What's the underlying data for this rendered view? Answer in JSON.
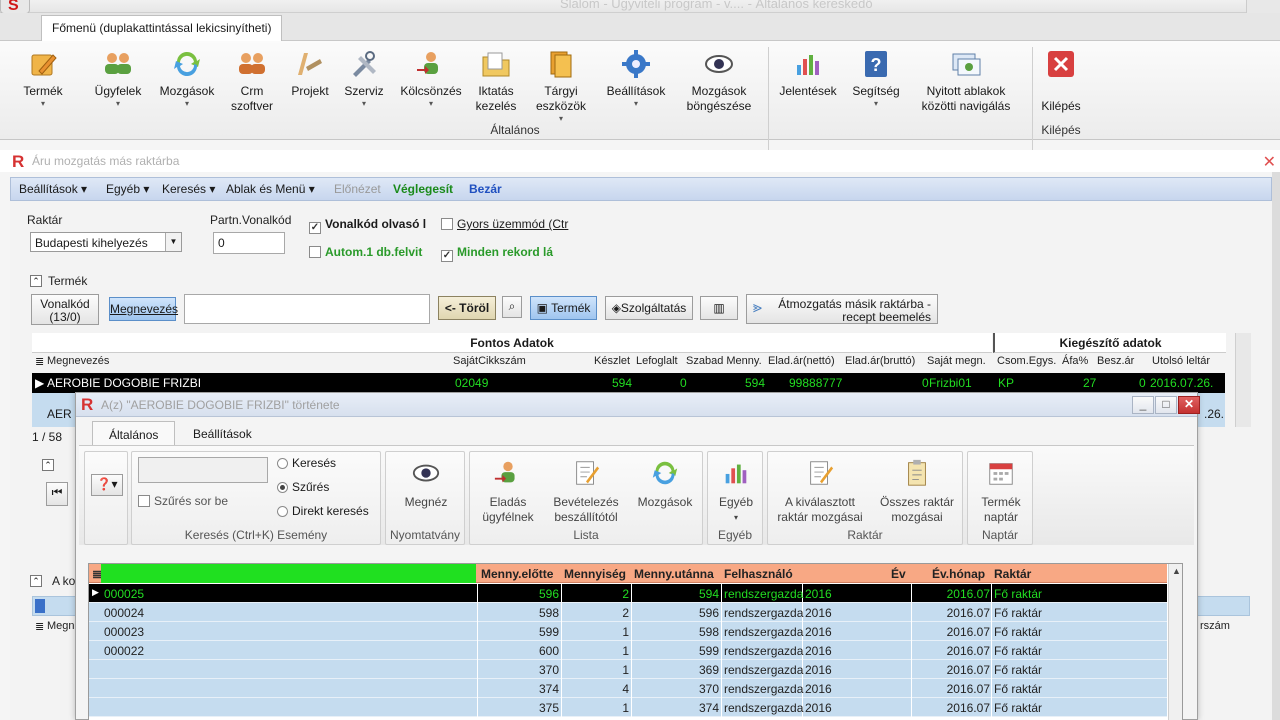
{
  "app": {
    "logo_letter": "S",
    "title": "Slalom - Ügyviteli program - v.... - Általános kereskedő",
    "main_tab": "Főmenü (duplakattintással lekicsinyítheti)"
  },
  "ribbon": {
    "buttons": [
      {
        "label": "Termék",
        "icon": "product-icon"
      },
      {
        "label": "Ügyfelek",
        "icon": "customers-icon"
      },
      {
        "label": "Mozgások",
        "icon": "movements-icon"
      },
      {
        "label": "Crm szoftver",
        "icon": "crm-icon"
      },
      {
        "label": "Projekt",
        "icon": "project-icon"
      },
      {
        "label": "Szerviz",
        "icon": "service-icon"
      },
      {
        "label": "Kölcsönzés",
        "icon": "rental-icon"
      },
      {
        "label": "Iktatás kezelés",
        "icon": "filing-icon"
      },
      {
        "label": "Tárgyi eszközök",
        "icon": "assets-icon"
      },
      {
        "label": "Beállítások",
        "icon": "settings-gear-icon"
      },
      {
        "label": "Mozgások böngészése",
        "icon": "browse-eye-icon"
      },
      {
        "label": "Jelentések",
        "icon": "reports-chart-icon"
      },
      {
        "label": "Segítség",
        "icon": "help-icon"
      },
      {
        "label": "Nyitott ablakok közötti navigálás",
        "icon": "windows-nav-icon"
      },
      {
        "label": "Kilépés",
        "icon": "exit-icon"
      }
    ],
    "group_general": "Általános",
    "group_exit": "Kilépés"
  },
  "form": {
    "title": "Áru mozgatás más raktárba",
    "menu": {
      "settings": "Beállítások",
      "other": "Egyéb",
      "search": "Keresés",
      "window_menu": "Ablak és Menü",
      "preview": "Előnézet",
      "finalize": "Véglegesít",
      "close": "Bezár"
    },
    "warehouse_label": "Raktár",
    "warehouse_value": "Budapesti kihelyezés",
    "partner_barcode_label": "Partn.Vonalkód",
    "partner_barcode_value": "0",
    "chk_barcode_reader": "Vonalkód olvasó l",
    "chk_fast_mode": "Gyors üzemmód (Ctr",
    "chk_auto_one": "Autom.1 db.felvit",
    "chk_all_records": "Minden rekord lá",
    "product_section": "Termék",
    "btn_barcode": "Vonalkód\n(13/0)",
    "btn_name": "Megnevezés",
    "search_value": "",
    "btn_delete": "<- Töröl",
    "btn_product": "Termék",
    "btn_service": "Szolgáltatás",
    "btn_move": "Átmozgatás másik raktárba - recept beemelés",
    "band_important": "Fontos Adatok",
    "band_extra": "Kiegészítő adatok",
    "columns": [
      "Megnevezés",
      "SajátCikkszám",
      "Készlet",
      "Lefoglalt",
      "Szabad Menny.",
      "Elad.ár(nettó)",
      "Elad.ár(bruttó)",
      "Saját megn.",
      "Csom.Egys.",
      "Áfa%",
      "Besz.ár",
      "Utolsó leltár"
    ],
    "row1": {
      "name": "AEROBIE DOGOBIE FRIZBI",
      "code": "02049",
      "stock": "594",
      "reserved": "0",
      "free": "594",
      "net": "99888777",
      "gross": "0",
      "own": "Frizbi01",
      "pack": "KP",
      "vat": "27",
      "buy": "0",
      "inventory": "2016.07.26."
    },
    "row2_partial": "AER",
    "row2_date": ".26.",
    "page_indicator": "1 / 58",
    "lower_section": "A ko",
    "lower_col": "Megn",
    "lower_col_right": "rszám"
  },
  "dialog": {
    "title": "A(z) \"AEROBIE DOGOBIE FRIZBI\" története",
    "tabs": [
      "Általános",
      "Beállítások"
    ],
    "search_value": "",
    "chk_filter": "Szűrés sor be",
    "radio_search": "Keresés",
    "radio_filter": "Szűrés",
    "radio_direct": "Direkt keresés",
    "group_search": "Keresés (Ctrl+K) Esemény",
    "btn_view": "Megnéz",
    "group_print": "Nyomtatvány",
    "btn_sale_customer": "Eladás ügyfélnek",
    "btn_purchase": "Bevételezés beszállítótól",
    "btn_movements": "Mozgások",
    "group_list": "Lista",
    "btn_other": "Egyéb",
    "group_other": "Egyéb",
    "btn_selected_wh": "A kiválasztott raktár mozgásai",
    "btn_all_wh": "Összes raktár mozgásai",
    "group_wh": "Raktár",
    "btn_product_calendar": "Termék naptár",
    "group_calendar": "Naptár",
    "grid_columns": [
      "",
      "Menny.előtte",
      "Mennyiség",
      "Menny.utánna",
      "Felhasználó",
      "Év",
      "Év.hónap",
      "Raktár"
    ],
    "rows": [
      [
        "000025",
        "596",
        "2",
        "594",
        "rendszergazda",
        "2016",
        "2016.07",
        "Fő raktár"
      ],
      [
        "000024",
        "598",
        "2",
        "596",
        "rendszergazda",
        "2016",
        "2016.07",
        "Fő raktár"
      ],
      [
        "000023",
        "599",
        "1",
        "598",
        "rendszergazda",
        "2016",
        "2016.07",
        "Fő raktár"
      ],
      [
        "000022",
        "600",
        "1",
        "599",
        "rendszergazda",
        "2016",
        "2016.07",
        "Fő raktár"
      ],
      [
        "",
        "370",
        "1",
        "369",
        "rendszergazda",
        "2016",
        "2016.07",
        "Fő raktár"
      ],
      [
        "",
        "374",
        "4",
        "370",
        "rendszergazda",
        "2016",
        "2016.07",
        "Fő raktár"
      ],
      [
        "",
        "375",
        "1",
        "374",
        "rendszergazda",
        "2016",
        "2016.07",
        "Fő raktár"
      ]
    ]
  },
  "colors": {
    "grid_header": "#f8a884",
    "grid_row": "#c5dcef",
    "selected_text": "#22dd22",
    "accent_green": "#2a9a2a",
    "close_red": "#c43030"
  }
}
